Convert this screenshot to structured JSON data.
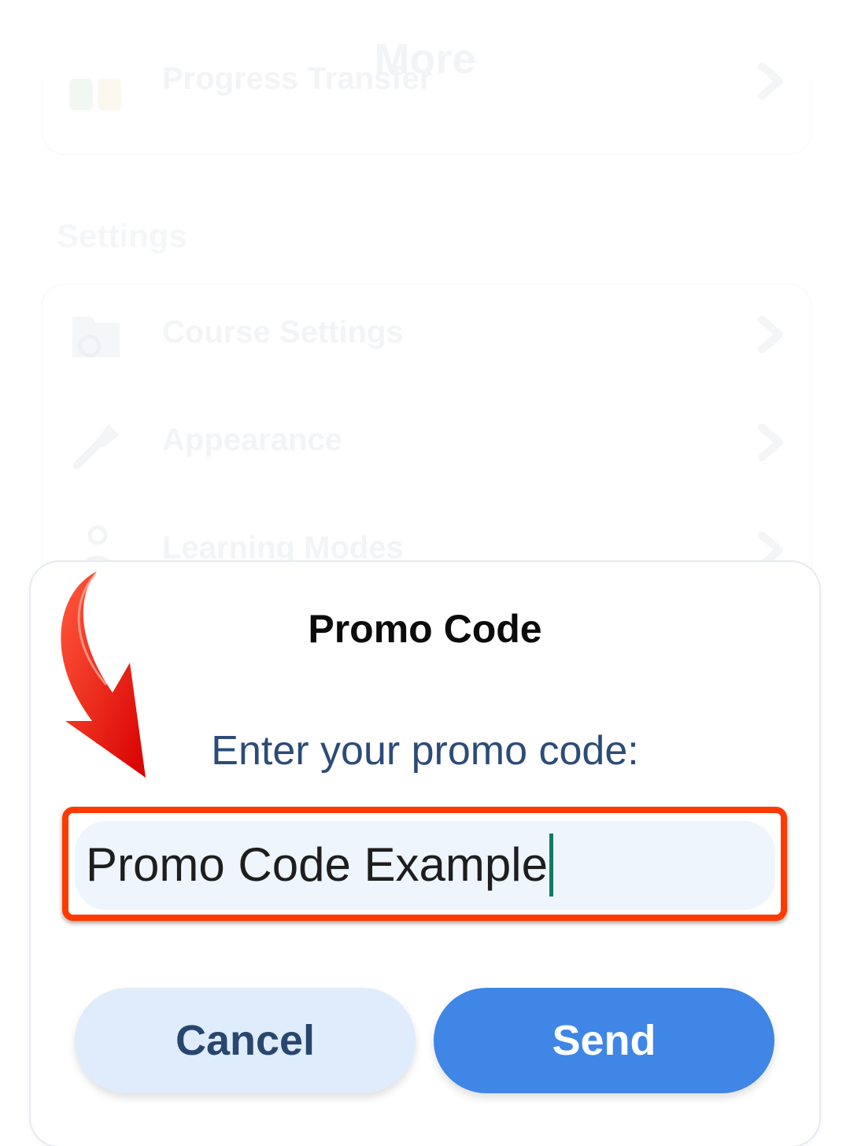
{
  "background": {
    "title": "More",
    "top_item_label": "Progress Transfer",
    "section_title": "Settings",
    "items": [
      {
        "label": "Course Settings",
        "icon": "folder-gear-icon"
      },
      {
        "label": "Appearance",
        "icon": "brush-icon"
      },
      {
        "label": "Learning Modes",
        "icon": "modes-icon"
      }
    ]
  },
  "dialog": {
    "title": "Promo Code",
    "prompt": "Enter your promo code:",
    "input_value": "Promo Code Example",
    "cancel_label": "Cancel",
    "send_label": "Send"
  },
  "colors": {
    "highlight": "#ff3a00",
    "send_button": "#3f86e6",
    "cancel_button": "#dfecfb",
    "prompt_text": "#2c4c78",
    "arrow": "#e00000"
  }
}
